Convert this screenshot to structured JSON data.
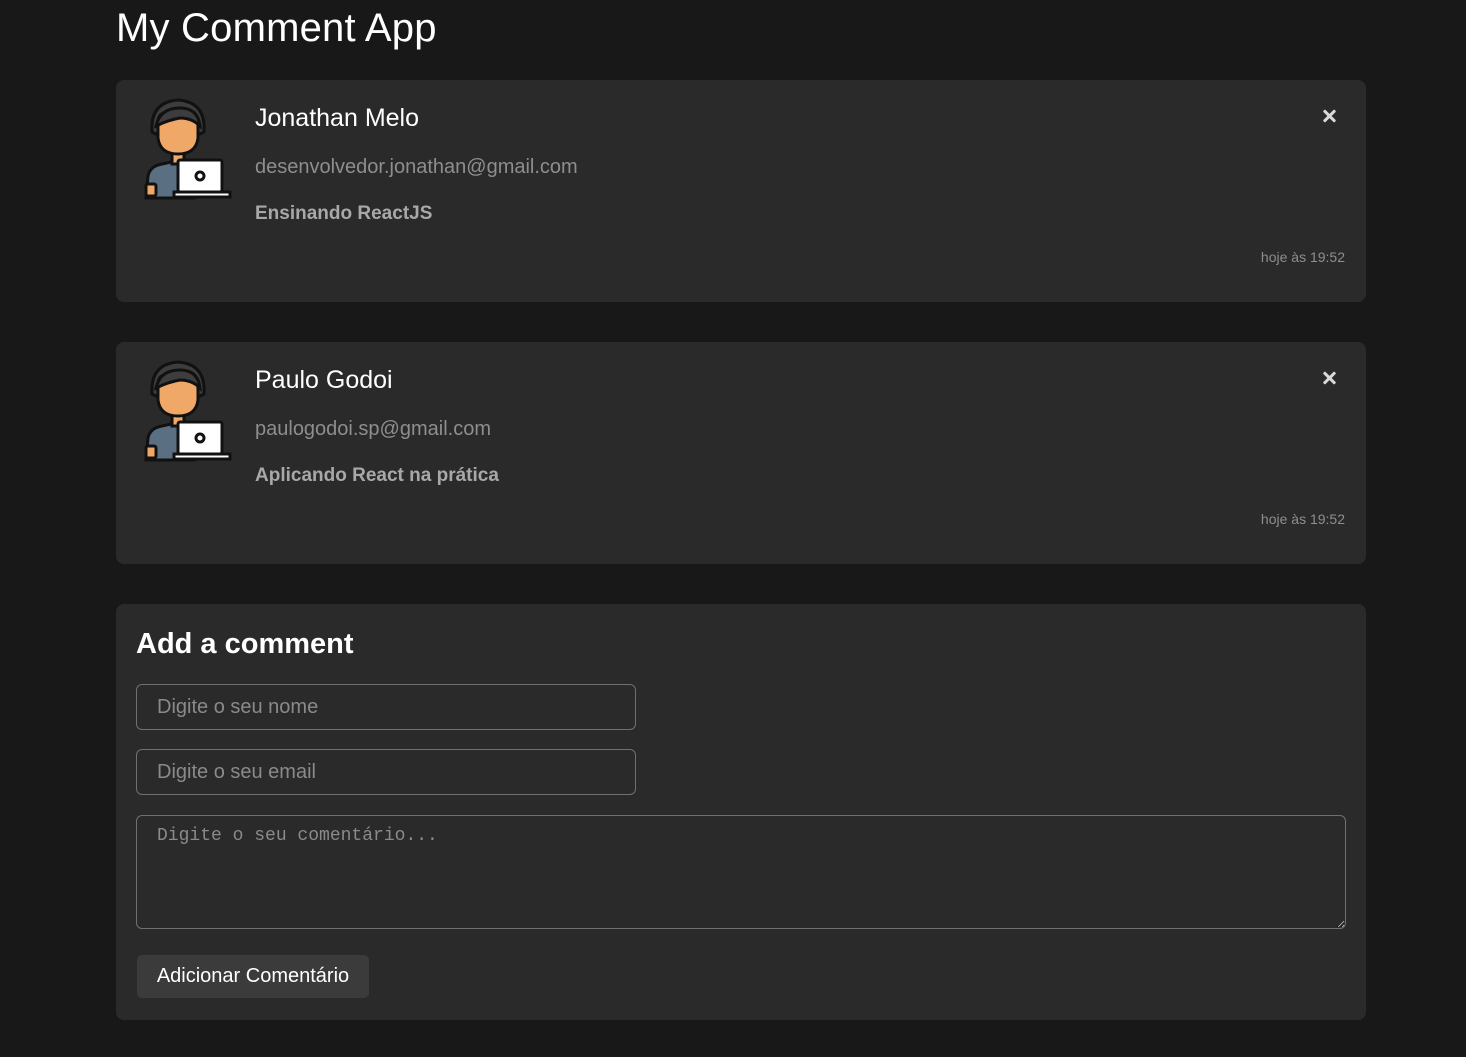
{
  "app": {
    "title": "My Comment App"
  },
  "comments": [
    {
      "name": "Jonathan Melo",
      "email": "desenvolvedor.jonathan@gmail.com",
      "text": "Ensinando ReactJS",
      "time": "hoje às 19:52",
      "avatar_icon": "developer-avatar-icon",
      "delete_icon": "close-icon"
    },
    {
      "name": "Paulo Godoi",
      "email": "paulogodoi.sp@gmail.com",
      "text": "Aplicando React na prática",
      "time": "hoje às 19:52",
      "avatar_icon": "developer-avatar-icon",
      "delete_icon": "close-icon"
    }
  ],
  "form": {
    "title": "Add a comment",
    "name_placeholder": "Digite o seu nome",
    "email_placeholder": "Digite o seu email",
    "comment_placeholder": "Digite o seu comentário...",
    "name_value": "",
    "email_value": "",
    "comment_value": "",
    "submit_label": "Adicionar Comentário"
  },
  "colors": {
    "background": "#181818",
    "card": "#2a2a2a",
    "muted_text": "#8e8e8e",
    "skin": "#f0a868",
    "hair": "#3d3d3d",
    "shirt": "#5a6f82"
  }
}
